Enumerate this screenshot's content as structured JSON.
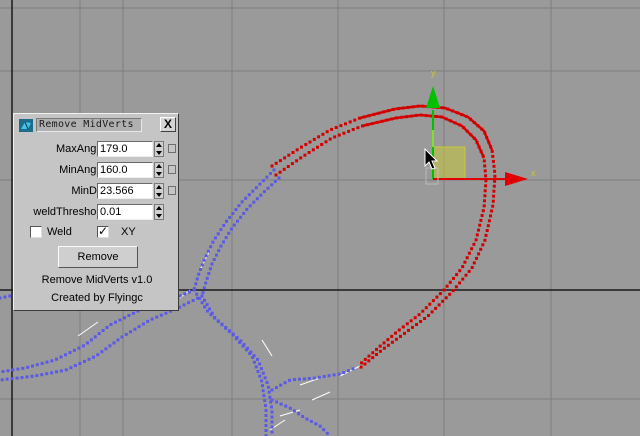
{
  "dialog": {
    "title": "Remove MidVerts",
    "close_label": "X",
    "fields": [
      {
        "label": "MaxAngle:",
        "value": "179.0",
        "has_lock": true
      },
      {
        "label": "MinAngle:",
        "value": "160.0",
        "has_lock": true
      },
      {
        "label": "MinDis:",
        "value": "23.566",
        "has_lock": true
      },
      {
        "label": "weldThreshold:",
        "value": "0.01",
        "has_lock": false
      }
    ],
    "checkboxes": [
      {
        "label": "Weld",
        "checked": false
      },
      {
        "label": "XY",
        "checked": true
      }
    ],
    "action_label": "Remove",
    "info_line1": "Remove MidVerts v1.0",
    "info_line2": "Created by Flyingc"
  },
  "gizmo": {
    "x_axis_label": "x",
    "y_axis_label": "y",
    "colors": {
      "x": "#e00000",
      "y": "#00c000",
      "plane": "#c8c83a"
    }
  },
  "viewport": {
    "background": "#9a9a9a",
    "grid_color": "#7e7e7e",
    "axis_line_color": "#1a1a1a",
    "selected_spline_color": "#d40000",
    "unselected_spline_color": "#5a5ae6",
    "segment_color": "#ffffff"
  },
  "icons": {
    "app": "teapot-icon",
    "close": "close-icon",
    "cursor": "arrow-cursor-icon"
  }
}
